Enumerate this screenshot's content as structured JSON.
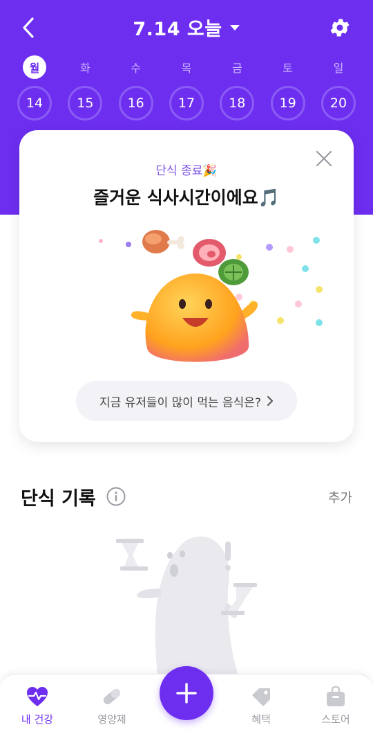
{
  "header": {
    "title": "7.14 오늘",
    "back_icon": "chevron-left-icon",
    "settings_icon": "gear-icon",
    "dropdown_icon": "caret-down-icon",
    "accent": "#6d2ef0"
  },
  "week": {
    "days": [
      {
        "label": "월",
        "date": "14",
        "active": true
      },
      {
        "label": "화",
        "date": "15"
      },
      {
        "label": "수",
        "date": "16"
      },
      {
        "label": "목",
        "date": "17"
      },
      {
        "label": "금",
        "date": "18"
      },
      {
        "label": "토",
        "date": "19"
      },
      {
        "label": "일",
        "date": "20"
      }
    ]
  },
  "card": {
    "tag": "단식 종료🎉",
    "title": "즐거운 식사시간이에요🎵",
    "cta": "지금 유저들이 많이 먹는 음식은?",
    "cta_icon": "chevron-right-icon",
    "close_icon": "close-icon"
  },
  "section": {
    "title": "단식 기록",
    "info_icon": "info-icon",
    "add_label": "추가"
  },
  "tabbar": {
    "tabs": [
      {
        "label": "내 건강",
        "icon": "heart-pulse-icon",
        "active": true
      },
      {
        "label": "영양제",
        "icon": "pill-icon"
      },
      {
        "label": "",
        "icon": "plus-icon"
      },
      {
        "label": "혜택",
        "icon": "tag-icon"
      },
      {
        "label": "스토어",
        "icon": "shopping-bag-icon"
      }
    ]
  }
}
